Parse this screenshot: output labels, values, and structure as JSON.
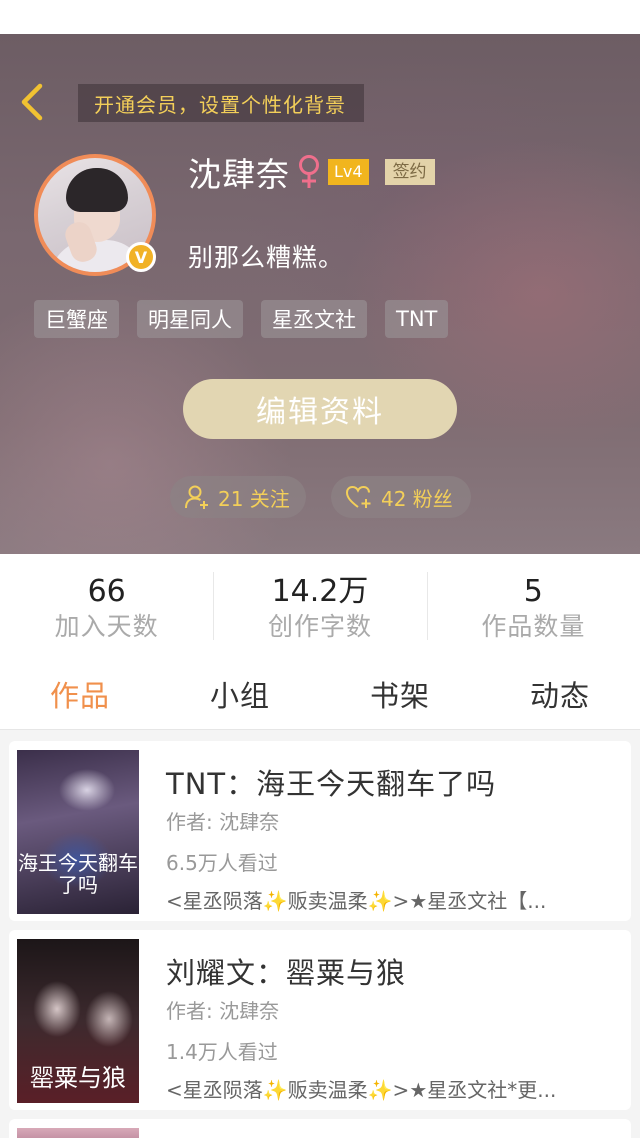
{
  "header": {
    "vip_banner": "开通会员，设置个性化背景"
  },
  "profile": {
    "username": "沈肆奈",
    "gender_symbol": "♀",
    "level": "Lv4",
    "signed_badge": "签约",
    "verified_badge": "V",
    "bio": "别那么糟糕。",
    "tags": [
      "巨蟹座",
      "明星同人",
      "星丞文社",
      "TNT"
    ],
    "edit_button": "编辑资料",
    "following": "21 关注",
    "fans": "42 粉丝"
  },
  "stats": [
    {
      "value": "66",
      "label": "加入天数"
    },
    {
      "value": "14.2万",
      "label": "创作字数"
    },
    {
      "value": "5",
      "label": "作品数量"
    }
  ],
  "tabs": [
    {
      "label": "作品",
      "active": true
    },
    {
      "label": "小组",
      "active": false
    },
    {
      "label": "书架",
      "active": false
    },
    {
      "label": "动态",
      "active": false
    }
  ],
  "books": [
    {
      "title": "TNT：海王今天翻车了吗",
      "author": "作者: 沈肆奈",
      "views": "6.5万人看过",
      "desc": "<星丞陨落✨贩卖温柔✨>★星丞文社【...",
      "cover_text": "海王今天翻车了吗"
    },
    {
      "title": "刘耀文：罂粟与狼",
      "author": "作者: 沈肆奈",
      "views": "1.4万人看过",
      "desc": "<星丞陨落✨贩卖温柔✨>★星丞文社*更...",
      "cover_text": "罂粟与狼"
    }
  ],
  "colors": {
    "accent_orange": "#f0904c",
    "vip_gold": "#f3cf59",
    "level_badge": "#f1b51e",
    "edit_button": "#e2d6b2",
    "avatar_ring": "#f08c58"
  },
  "icons": {
    "back": "chevron-left-icon",
    "gender": "female-icon",
    "follow": "add-person-icon",
    "fans": "heart-plus-icon"
  }
}
